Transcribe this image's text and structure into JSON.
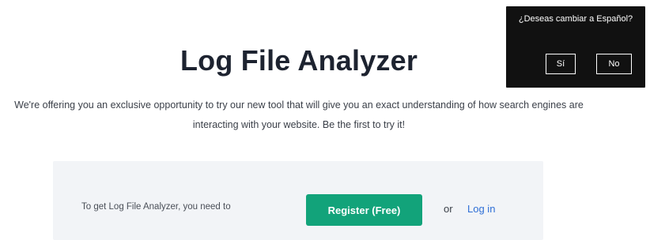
{
  "page": {
    "title": "Log File Analyzer",
    "intro": "We're offering you an exclusive opportunity to try our new tool that will give you an exact understanding of how search engines are interacting with your website. Be the first to try it!"
  },
  "cta": {
    "prompt": "To get Log File Analyzer, you need to",
    "register_label": "Register (Free)",
    "or_text": "or",
    "login_label": "Log in"
  },
  "language_popup": {
    "question": "¿Deseas cambiar a Español?",
    "yes_label": "Sí",
    "no_label": "No"
  },
  "colors": {
    "register_button": "#12a37a",
    "login_link": "#2f6fd6",
    "popup_background": "#111111",
    "panel_background": "#f2f4f7"
  }
}
